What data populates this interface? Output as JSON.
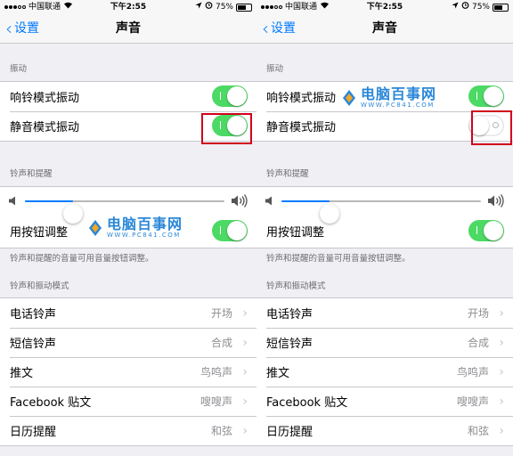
{
  "status_bar": {
    "carrier": "中国联通",
    "time": "下午2:55",
    "battery": "75%",
    "battery_level": 0.75
  },
  "nav": {
    "back_label": "设置",
    "title": "声音"
  },
  "vibrate_section": {
    "header": "振动",
    "items": [
      {
        "label": "响铃模式振动"
      },
      {
        "label": "静音模式振动"
      }
    ]
  },
  "ringer_section": {
    "header": "铃声和提醒",
    "volume_level": 0.24,
    "change_with_buttons_label": "用按钮调整",
    "footer": "铃声和提醒的音量可用音量按钮调整。"
  },
  "patterns_section": {
    "header": "铃声和振动模式",
    "items": [
      {
        "label": "电话铃声",
        "value": "开场"
      },
      {
        "label": "短信铃声",
        "value": "合成"
      },
      {
        "label": "推文",
        "value": "鸟鸣声"
      },
      {
        "label": "Facebook 贴文",
        "value": "嗖嗖声"
      },
      {
        "label": "日历提醒",
        "value": "和弦"
      }
    ]
  },
  "screens": [
    {
      "name": "left",
      "ring_vibrate_on": true,
      "silent_vibrate_on": true,
      "change_with_buttons_on": true
    },
    {
      "name": "right",
      "ring_vibrate_on": true,
      "silent_vibrate_on": false,
      "change_with_buttons_on": true
    }
  ],
  "watermark": {
    "title": "电脑百事网",
    "subtitle": "WWW.PC841.COM"
  },
  "colors": {
    "accent": "#007aff",
    "toggle_on": "#4cd964",
    "highlight": "#d0021b",
    "watermark": "#2a87d8"
  }
}
